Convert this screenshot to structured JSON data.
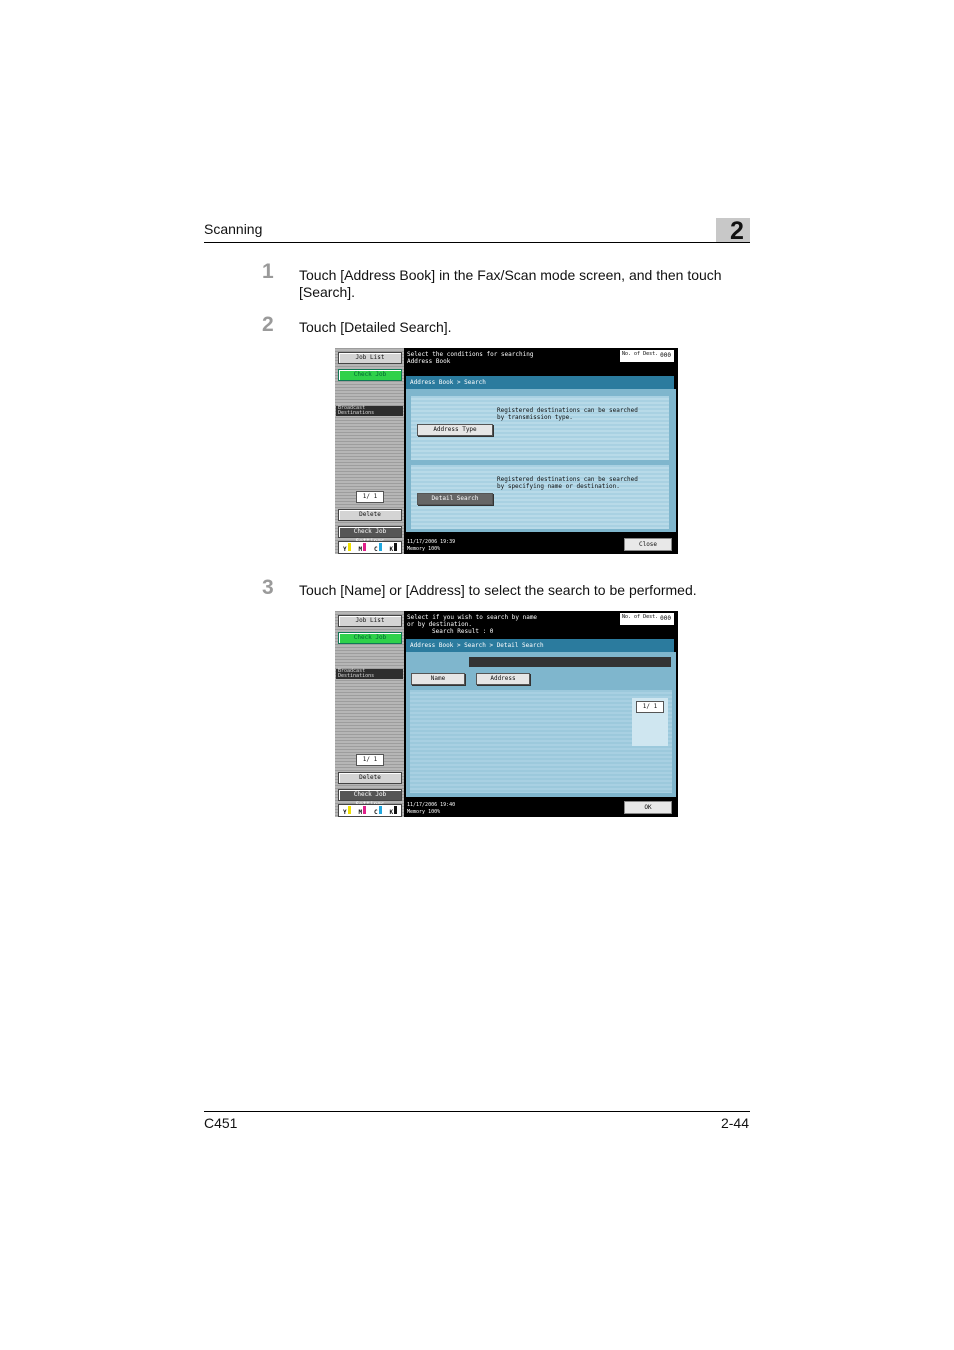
{
  "header": {
    "section_title": "Scanning",
    "chapter_number": "2"
  },
  "footer": {
    "model": "C451",
    "page": "2-44"
  },
  "steps": [
    {
      "number": "1",
      "text": "Touch [Address Book] in the Fax/Scan mode screen, and then touch [Search]."
    },
    {
      "number": "2",
      "text": "Touch [Detailed Search]."
    },
    {
      "number": "3",
      "text": "Touch [Name] or [Address] to select the search to be performed."
    }
  ],
  "screen1": {
    "side": {
      "job_list": "Job List",
      "check_job": "Check Job",
      "dest_label": "Broadcast Destinations",
      "page": "1/  1",
      "delete": "Delete",
      "settings": "Check Job Settings"
    },
    "top_message": "Select the conditions for searching Address Book",
    "counter_label": "No. of Dest.",
    "counter_value": "000",
    "breadcrumb": "Address Book > Search",
    "card1_text": "Registered destinations can be searched by transmission type.",
    "card1_button": "Address Type",
    "card2_text": "Registered destinations can be searched by specifying name or destination.",
    "card2_button": "Detail Search",
    "status_datetime": "11/17/2006    19:39",
    "status_memory": "Memory        100%",
    "close_button": "Close"
  },
  "screen2": {
    "side": {
      "job_list": "Job List",
      "check_job": "Check Job",
      "dest_label": "Broadcast Destinations",
      "page": "1/  1",
      "delete": "Delete",
      "settings": "Check Job Settings"
    },
    "top_message": "Select if you wish to search by name or by destination.",
    "search_result": "Search Result  :    0",
    "counter_label": "No. of Dest.",
    "counter_value": "000",
    "breadcrumb": "Address Book > Search > Detail Search",
    "name_button": "Name",
    "address_button": "Address",
    "list_page": "1/  1",
    "status_datetime": "11/17/2006    19:40",
    "status_memory": "Memory        100%",
    "ok_button": "OK"
  },
  "toner": {
    "labels": [
      "Y",
      "M",
      "C",
      "K"
    ],
    "colors": [
      "#f0e000",
      "#e0208a",
      "#20a8e0",
      "#111111"
    ]
  }
}
